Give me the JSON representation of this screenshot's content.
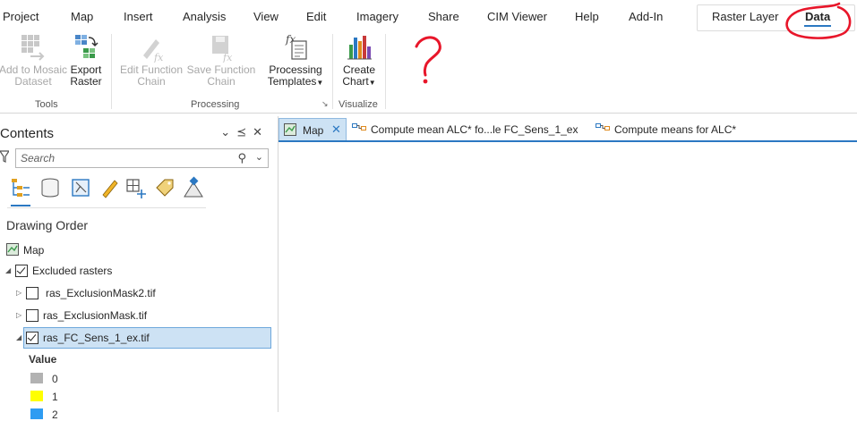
{
  "ribbon_tabs": [
    {
      "label": "Project"
    },
    {
      "label": "Map"
    },
    {
      "label": "Insert"
    },
    {
      "label": "Analysis"
    },
    {
      "label": "View"
    },
    {
      "label": "Edit"
    },
    {
      "label": "Imagery"
    },
    {
      "label": "Share"
    },
    {
      "label": "CIM Viewer"
    },
    {
      "label": "Help"
    },
    {
      "label": "Add-In"
    }
  ],
  "contextual_tabs": {
    "raster_layer": "Raster Layer",
    "data": "Data"
  },
  "ribbon": {
    "tools_group": {
      "label": "Tools",
      "add_to_mosaic": {
        "line1": "Add to Mosaic",
        "line2": "Dataset"
      },
      "export_raster": {
        "line1": "Export",
        "line2": "Raster"
      }
    },
    "processing_group": {
      "label": "Processing",
      "edit_function_chain": {
        "line1": "Edit Function",
        "line2": "Chain"
      },
      "save_function_chain": {
        "line1": "Save Function",
        "line2": "Chain"
      },
      "processing_templates": {
        "line1": "Processing",
        "line2": "Templates"
      }
    },
    "visualize_group": {
      "label": "Visualize",
      "create_chart": {
        "line1": "Create",
        "line2": "Chart"
      }
    }
  },
  "contents": {
    "title": "Contents",
    "search_placeholder": "Search",
    "section_heading": "Drawing Order",
    "tree": {
      "map": "Map",
      "group": "Excluded rasters",
      "layers": [
        {
          "name": "ras_ExclusionMask2.tif",
          "checked": false
        },
        {
          "name": "ras_ExclusionMask.tif",
          "checked": false
        },
        {
          "name": "ras_FC_Sens_1_ex.tif",
          "checked": true
        }
      ]
    },
    "legend": {
      "heading": "Value",
      "entries": [
        {
          "label": "0",
          "color": "#b2b2b2"
        },
        {
          "label": "1",
          "color": "#ffff00"
        },
        {
          "label": "2",
          "color": "#2e9cf2"
        }
      ]
    }
  },
  "view_tabs": [
    {
      "label": "Map",
      "active": true
    },
    {
      "label": "Compute mean ALC* fo...le FC_Sens_1_ex",
      "active": false
    },
    {
      "label": "Compute means for ALC*",
      "active": false
    }
  ],
  "colors": {
    "accent": "#2b78c2",
    "selection": "#cde2f4",
    "annotation": "#e8162a"
  }
}
